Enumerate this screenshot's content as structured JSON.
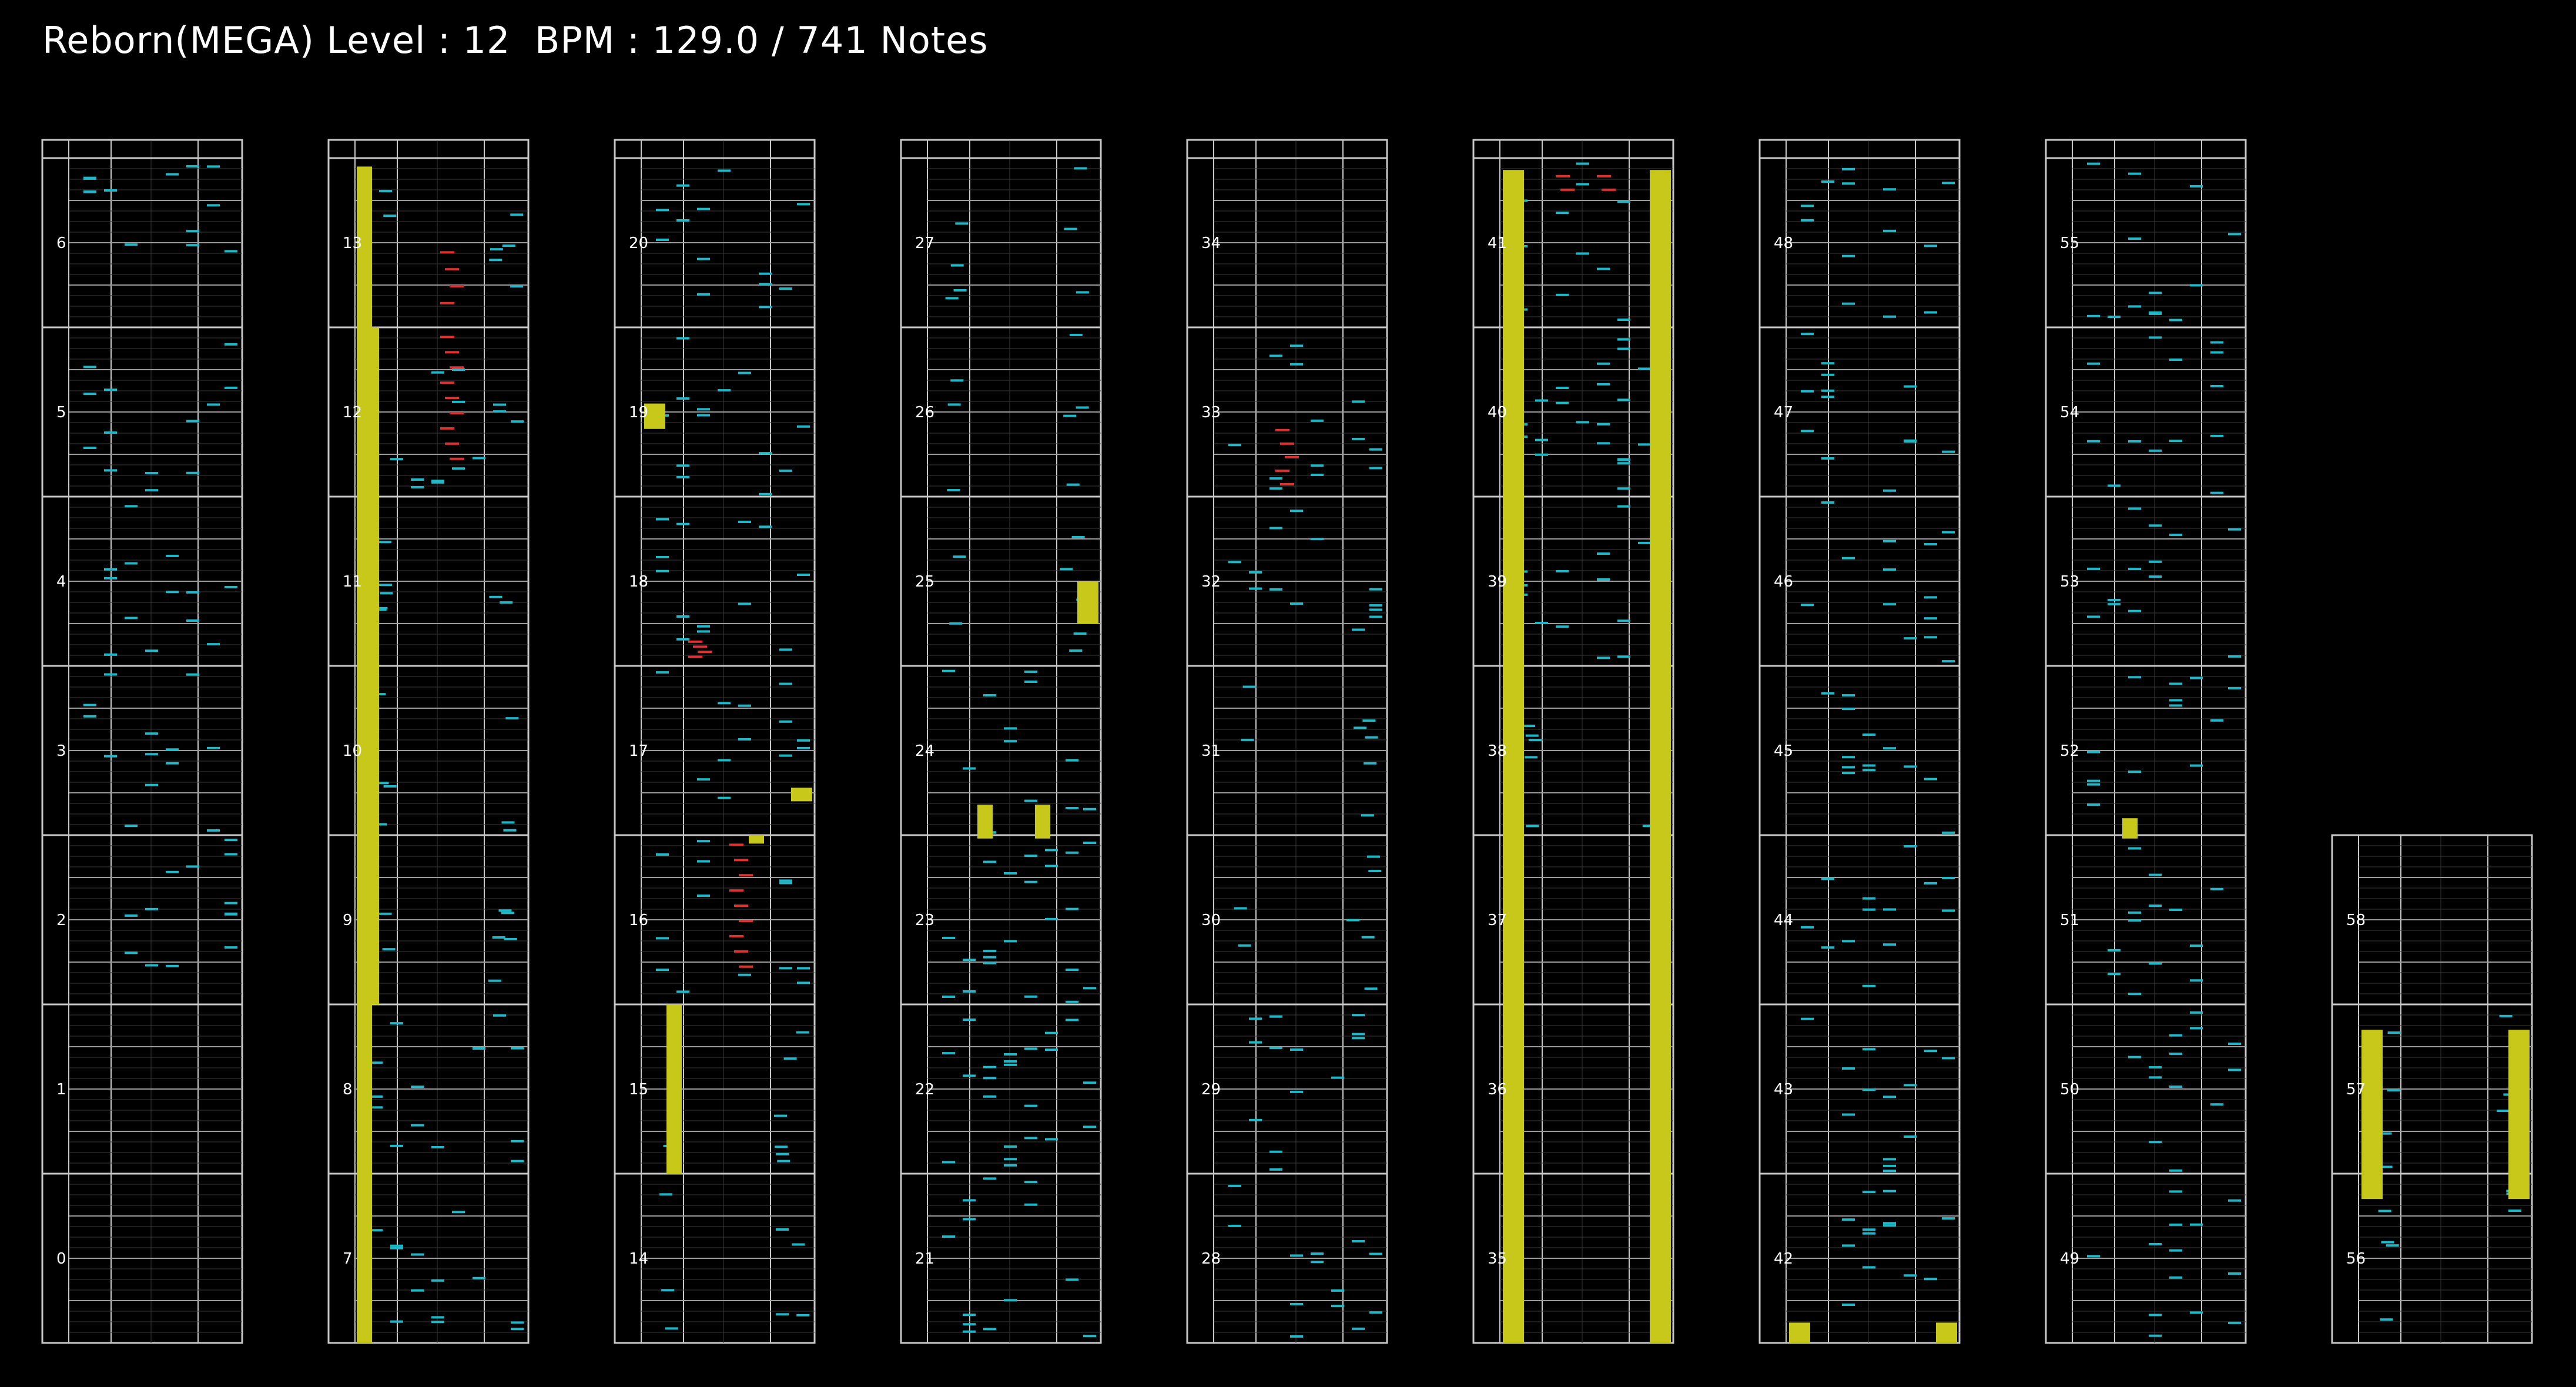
{
  "header": {
    "song": "Reborn(MEGA)",
    "level_text": "Level : 12",
    "bpm_text": "BPM : 129.0",
    "notes_text": "741 Notes",
    "full": "Reborn(MEGA) Level : 12  BPM : 129.0 / 741 Notes"
  },
  "colors": {
    "background": "#000000",
    "grid": "#c8c8c8",
    "tap_note": "#1fb8c8",
    "slide_note": "#e03030",
    "hold_note": "#c8c81a",
    "label": "#ffffff"
  },
  "measure_numbers": [
    "0",
    "1",
    "2",
    "3",
    "4",
    "5",
    "6",
    "7",
    "8",
    "9",
    "10",
    "11",
    "12",
    "13",
    "14",
    "15",
    "16",
    "17",
    "18",
    "19",
    "20",
    "21",
    "22",
    "23",
    "24",
    "25",
    "26",
    "27",
    "28",
    "29",
    "30",
    "31",
    "32",
    "33",
    "34",
    "35",
    "36",
    "37",
    "38",
    "39",
    "40",
    "41",
    "42",
    "43",
    "44",
    "45",
    "46",
    "47",
    "48",
    "49",
    "50",
    "51",
    "52",
    "53",
    "54",
    "55",
    "56",
    "57",
    "58"
  ],
  "note_density": {
    "0": "none",
    "1": "none",
    "2": "medium",
    "3": "medium",
    "4": "medium",
    "5": "medium",
    "6": "medium",
    "7": "medium",
    "8": "medium",
    "9": "light",
    "10": "light",
    "11": "light",
    "12": "medium",
    "13": "light",
    "14": "light",
    "15": "light",
    "16": "medium",
    "17": "medium",
    "18": "medium",
    "19": "medium",
    "20": "medium",
    "21": "medium",
    "22": "dense",
    "23": "dense",
    "24": "medium",
    "25": "light",
    "26": "light",
    "27": "light",
    "28": "medium",
    "29": "medium",
    "30": "light",
    "31": "light",
    "32": "medium",
    "33": "medium",
    "34": "none",
    "35": "none",
    "36": "none",
    "37": "none",
    "38": "light",
    "39": "medium",
    "40": "dense",
    "41": "medium",
    "42": "medium",
    "43": "medium",
    "44": "medium",
    "45": "medium",
    "46": "medium",
    "47": "medium",
    "48": "medium",
    "49": "medium",
    "50": "medium",
    "51": "medium",
    "52": "medium",
    "53": "medium",
    "54": "medium",
    "55": "medium",
    "56": "light",
    "57": "light",
    "58": "none"
  },
  "hold_notes": [
    {
      "measure_start": 13.95,
      "measure_end": 14.0,
      "lane": "left-edge"
    },
    {
      "measure_start": 19.4,
      "measure_end": 19.55,
      "lane": "left"
    },
    {
      "measure_start": 13.0,
      "measure_end": 16.0,
      "lane": "left"
    },
    {
      "measure_start": 15.0,
      "measure_end": 16.0,
      "lane": "left-inner"
    },
    {
      "measure_start": 16.95,
      "measure_end": 17.0,
      "lane": "center-right"
    },
    {
      "measure_start": 17.2,
      "measure_end": 17.28,
      "lane": "right"
    },
    {
      "measure_start": 25.25,
      "measure_end": 25.5,
      "lane": "right"
    },
    {
      "measure_start": 23.98,
      "measure_end": 24.18,
      "lane": "center-left"
    },
    {
      "measure_start": 23.98,
      "measure_end": 24.18,
      "lane": "center-right"
    },
    {
      "measure_start": 41.93,
      "measure_end": 42.0,
      "lane": "left"
    },
    {
      "measure_start": 41.93,
      "measure_end": 42.0,
      "lane": "right"
    },
    {
      "measure_start": 42.0,
      "measure_end": 42.12,
      "lane": "left"
    },
    {
      "measure_start": 42.0,
      "measure_end": 42.12,
      "lane": "right"
    },
    {
      "measure_start": 51.98,
      "measure_end": 52.1,
      "lane": "center-left"
    },
    {
      "measure_start": 56.85,
      "measure_end": 57.85,
      "lane": "left"
    },
    {
      "measure_start": 56.85,
      "measure_end": 57.85,
      "lane": "right"
    }
  ]
}
